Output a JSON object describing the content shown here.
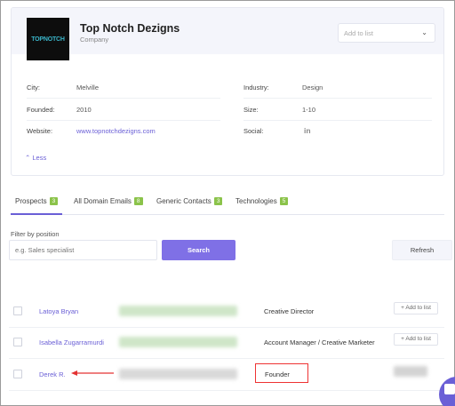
{
  "company": {
    "logo_text": "TOPNOTCH",
    "name": "Top Notch Dezigns",
    "type": "Company",
    "add_to_list_placeholder": "Add to list"
  },
  "details": {
    "city_label": "City:",
    "city_value": "Melville",
    "industry_label": "Industry:",
    "industry_value": "Design",
    "founded_label": "Founded:",
    "founded_value": "2010",
    "size_label": "Size:",
    "size_value": "1-10",
    "website_label": "Website:",
    "website_value": "www.topnotchdezigns.com",
    "social_label": "Social:",
    "social_icon_text": "in",
    "less_label": "Less"
  },
  "tabs": [
    {
      "label": "Prospects",
      "count": "3"
    },
    {
      "label": "All Domain Emails",
      "count": "8"
    },
    {
      "label": "Generic Contacts",
      "count": "3"
    },
    {
      "label": "Technologies",
      "count": "5"
    }
  ],
  "filter": {
    "label": "Filter by position",
    "placeholder": "e.g. Sales specialist",
    "search_label": "Search",
    "refresh_label": "Refresh"
  },
  "prospects": [
    {
      "name": "Latoya Bryan",
      "title": "Creative Director",
      "action": "+ Add to list"
    },
    {
      "name": "Isabella Zugarramurdi",
      "title": "Account Manager / Creative Marketer",
      "action": "+ Add to list"
    },
    {
      "name": "Derek R.",
      "title": "Founder",
      "action": ""
    }
  ],
  "colors": {
    "accent": "#6a5fd6",
    "button": "#7f70e6",
    "badge": "#8bc34a",
    "highlight": "#e33333"
  }
}
